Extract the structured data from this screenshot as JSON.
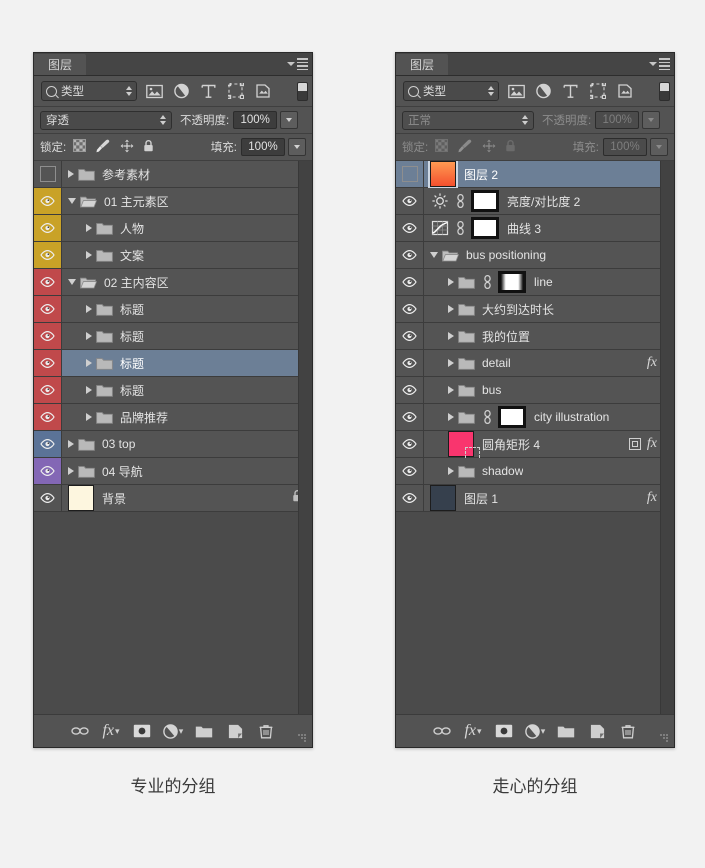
{
  "captions": {
    "left": "专业的分组",
    "right": "走心的分组"
  },
  "panel_left": {
    "tab_label": "图层",
    "menu_icon": "panel-menu-icon",
    "filter": {
      "search_icon": "search-icon",
      "kind_label": "类型",
      "icons": [
        "pixel-layer-icon",
        "adjustment-layer-icon",
        "type-layer-icon",
        "shape-layer-icon",
        "smart-object-icon"
      ],
      "toggle_icon": "filter-toggle-icon",
      "enabled": true
    },
    "blend": {
      "mode": "穿透",
      "opacity_label": "不透明度:",
      "opacity_value": "100%",
      "enabled": true
    },
    "lock": {
      "label": "锁定:",
      "icons": [
        "lock-transparent-pixels-icon",
        "lock-image-pixels-icon",
        "lock-position-icon",
        "lock-all-icon"
      ],
      "fill_label": "填充:",
      "fill_value": "100%",
      "enabled": true
    },
    "layers": [
      {
        "name": "参考素材",
        "type": "group",
        "visible": false,
        "expanded": false,
        "depth": 0,
        "color": "none",
        "selected": false
      },
      {
        "name": "01 主元素区",
        "type": "group",
        "visible": true,
        "expanded": true,
        "depth": 0,
        "color": "#c9a227",
        "selected": false
      },
      {
        "name": "人物",
        "type": "group",
        "visible": true,
        "expanded": false,
        "depth": 1,
        "color": "#c9a227",
        "selected": false
      },
      {
        "name": "文案",
        "type": "group",
        "visible": true,
        "expanded": false,
        "depth": 1,
        "color": "#c9a227",
        "selected": false
      },
      {
        "name": "02 主内容区",
        "type": "group",
        "visible": true,
        "expanded": true,
        "depth": 0,
        "color": "#c0494b",
        "selected": false
      },
      {
        "name": "标题",
        "type": "group",
        "visible": true,
        "expanded": false,
        "depth": 1,
        "color": "#c0494b",
        "selected": false
      },
      {
        "name": "标题",
        "type": "group",
        "visible": true,
        "expanded": false,
        "depth": 1,
        "color": "#c0494b",
        "selected": false
      },
      {
        "name": "标题",
        "type": "group",
        "visible": true,
        "expanded": false,
        "depth": 1,
        "color": "#c0494b",
        "selected": true
      },
      {
        "name": "标题",
        "type": "group",
        "visible": true,
        "expanded": false,
        "depth": 1,
        "color": "#c0494b",
        "selected": false
      },
      {
        "name": "品牌推荐",
        "type": "group",
        "visible": true,
        "expanded": false,
        "depth": 1,
        "color": "#c0494b",
        "selected": false
      },
      {
        "name": "03 top",
        "type": "group",
        "visible": true,
        "expanded": false,
        "depth": 0,
        "color": "#5b7397",
        "selected": false
      },
      {
        "name": "04 导航",
        "type": "group",
        "visible": true,
        "expanded": false,
        "depth": 0,
        "color": "#8367b5",
        "selected": false
      },
      {
        "name": "背景",
        "type": "pixel",
        "visible": true,
        "depth": 0,
        "color": "none",
        "selected": false,
        "thumb": "#fdf6df",
        "locked": true
      }
    ],
    "toolbar": [
      "link-layers-icon",
      "layer-style-fx-icon",
      "add-layer-mask-icon",
      "new-adjustment-layer-icon",
      "new-group-icon",
      "new-layer-icon",
      "delete-layer-icon"
    ]
  },
  "panel_right": {
    "tab_label": "图层",
    "menu_icon": "panel-menu-icon",
    "filter": {
      "search_icon": "search-icon",
      "kind_label": "类型",
      "icons": [
        "pixel-layer-icon",
        "adjustment-layer-icon",
        "type-layer-icon",
        "shape-layer-icon",
        "smart-object-icon"
      ],
      "toggle_icon": "filter-toggle-icon",
      "enabled": true
    },
    "blend": {
      "mode": "正常",
      "opacity_label": "不透明度:",
      "opacity_value": "100%",
      "enabled": false
    },
    "lock": {
      "label": "锁定:",
      "icons": [
        "lock-transparent-pixels-icon",
        "lock-image-pixels-icon",
        "lock-position-icon",
        "lock-all-icon"
      ],
      "fill_label": "填充:",
      "fill_value": "100%",
      "enabled": false
    },
    "layers": [
      {
        "name": "图层 2",
        "type": "pixel",
        "visible": false,
        "depth": 0,
        "selected": true,
        "thumb": "gradient-orange"
      },
      {
        "name": "亮度/对比度 2",
        "type": "adjustment",
        "adj_icon": "brightness-contrast-icon",
        "visible": true,
        "depth": 0,
        "mask": "white",
        "linked": true,
        "selected": false
      },
      {
        "name": "曲线 3",
        "type": "adjustment",
        "adj_icon": "curves-icon",
        "visible": true,
        "depth": 0,
        "mask": "white",
        "linked": true,
        "selected": false
      },
      {
        "name": "bus positioning",
        "type": "group",
        "visible": true,
        "expanded": true,
        "depth": 0,
        "selected": false
      },
      {
        "name": "line",
        "type": "group",
        "visible": true,
        "expanded": false,
        "depth": 1,
        "mask": "gradient",
        "linked": true,
        "selected": false
      },
      {
        "name": "大约到达时长",
        "type": "group",
        "visible": true,
        "expanded": false,
        "depth": 1,
        "selected": false
      },
      {
        "name": "我的位置",
        "type": "group",
        "visible": true,
        "expanded": false,
        "depth": 1,
        "selected": false
      },
      {
        "name": "detail",
        "type": "group",
        "visible": true,
        "expanded": false,
        "depth": 1,
        "selected": false,
        "fx": true,
        "expander": true
      },
      {
        "name": "bus",
        "type": "group",
        "visible": true,
        "expanded": false,
        "depth": 1,
        "selected": false
      },
      {
        "name": "city illustration",
        "type": "group",
        "visible": true,
        "expanded": false,
        "depth": 1,
        "mask": "white",
        "linked": true,
        "selected": false
      },
      {
        "name": "圆角矩形 4",
        "type": "shape",
        "visible": true,
        "depth": 1,
        "selected": false,
        "thumb": "#f9356e",
        "vector_mask": true,
        "smart_badge": true,
        "fx": true,
        "expander": true
      },
      {
        "name": "shadow",
        "type": "group",
        "visible": true,
        "expanded": false,
        "depth": 1,
        "selected": false
      },
      {
        "name": "图层 1",
        "type": "pixel",
        "visible": true,
        "depth": 0,
        "selected": false,
        "thumb": "#36404d",
        "fx": true,
        "expander": true
      }
    ],
    "toolbar": [
      "link-layers-icon",
      "layer-style-fx-icon",
      "add-layer-mask-icon",
      "new-adjustment-layer-icon",
      "new-group-icon",
      "new-layer-icon",
      "delete-layer-icon"
    ]
  }
}
